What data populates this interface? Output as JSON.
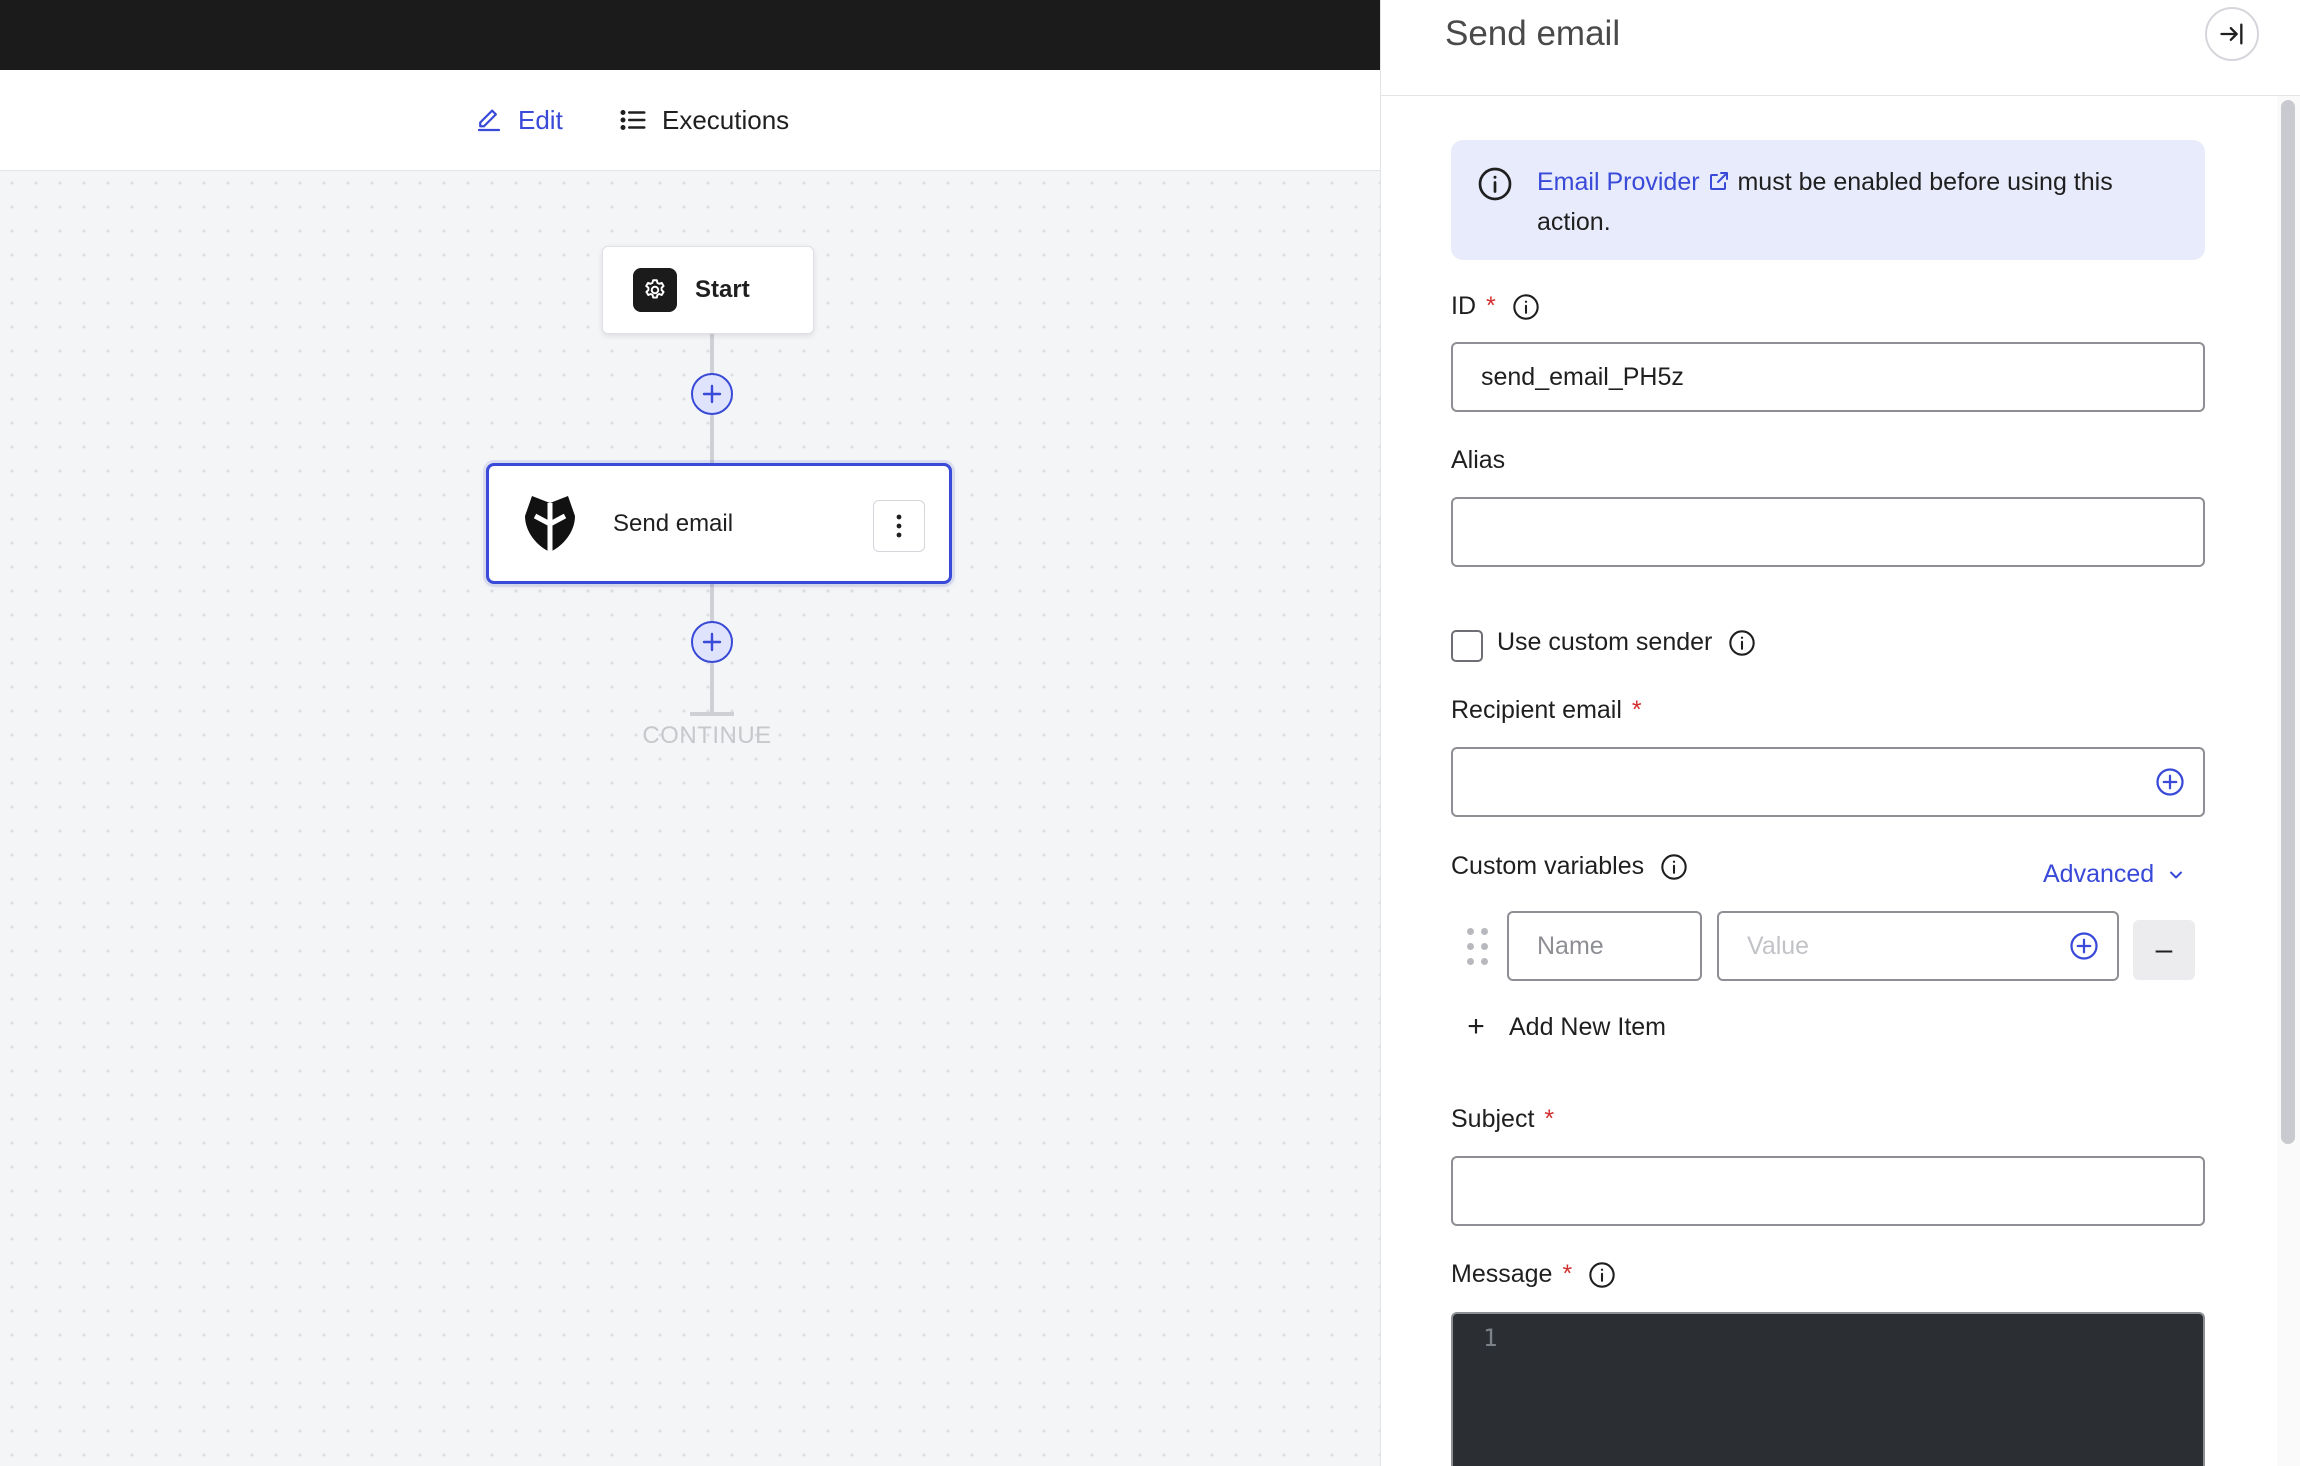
{
  "tabs": {
    "edit_label": "Edit",
    "executions_label": "Executions"
  },
  "flow": {
    "start_label": "Start",
    "action_label": "Send email",
    "end_label": "CONTINUE"
  },
  "panel": {
    "title": "Send email",
    "notice": {
      "link_text": "Email Provider",
      "text": "must be enabled before using this action."
    },
    "id_field": {
      "label": "ID",
      "required_mark": "*",
      "value": "send_email_PH5z"
    },
    "alias_field": {
      "label": "Alias",
      "value": ""
    },
    "custom_sender": {
      "label": "Use custom sender",
      "checked": false
    },
    "recipient_field": {
      "label": "Recipient email",
      "required_mark": "*",
      "value": ""
    },
    "custom_variables": {
      "label": "Custom variables",
      "advanced_label": "Advanced",
      "name_placeholder": "Name",
      "value_placeholder": "Value",
      "remove_label": "–",
      "add_label": "Add New Item"
    },
    "subject_field": {
      "label": "Subject",
      "required_mark": "*",
      "value": ""
    },
    "message_field": {
      "label": "Message",
      "required_mark": "*",
      "line_number": "1"
    }
  },
  "colors": {
    "accent": "#3949d8",
    "required": "#d32f2f",
    "editor_bg": "#2b2f33",
    "topbar": "#1b1b1c"
  }
}
